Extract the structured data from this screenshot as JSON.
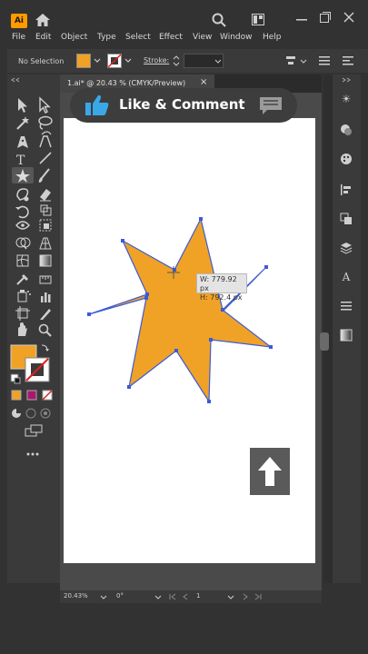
{
  "app": {
    "logo": "Ai"
  },
  "titlebar_icons": [
    "home-icon",
    "search-icon",
    "arrange-documents-icon",
    "minimize-icon",
    "restore-icon",
    "close-icon"
  ],
  "menu": [
    "File",
    "Edit",
    "Object",
    "Type",
    "Select",
    "Effect",
    "View",
    "Window",
    "Help"
  ],
  "control_bar": {
    "selection": "No Selection",
    "stroke_label": "Stroke:",
    "fill_color": "#f0a226",
    "stroke_color": "none"
  },
  "document": {
    "tab_title": "1.ai* @ 20.43 % (CMYK/Preview)",
    "close_label": "×"
  },
  "banner": {
    "text": "Like & Comment"
  },
  "tooltip": {
    "width": "W: 779.92 px",
    "height": "H: 792.4 px"
  },
  "status": {
    "zoom": "20.43%",
    "rotation": "0°",
    "artboard": "1"
  },
  "colors": {
    "fill": "#f0a226",
    "stroke": "#3b5bd6",
    "background": "#323232",
    "panel": "#3a3a3a",
    "artboard": "#ffffff"
  },
  "shape": {
    "type": "star",
    "points": 7
  }
}
